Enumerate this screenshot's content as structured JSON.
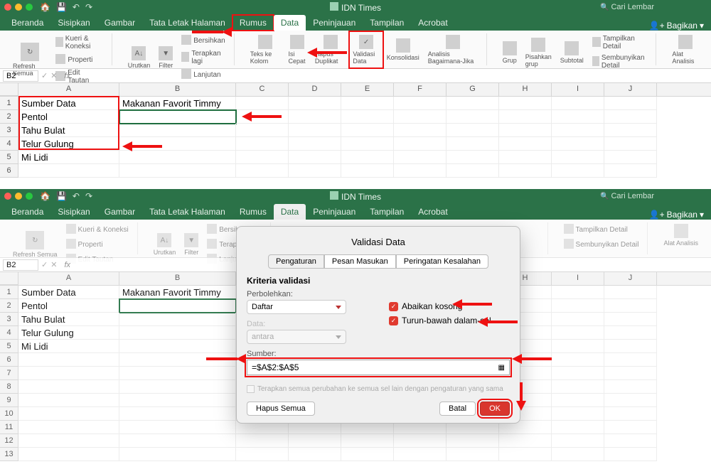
{
  "doc_title": "IDN Times",
  "search_placeholder": "Cari Lembar",
  "share_label": "Bagikan",
  "tabs": [
    "Beranda",
    "Sisipkan",
    "Gambar",
    "Tata Letak Halaman",
    "Rumus",
    "Data",
    "Peninjauan",
    "Tampilan",
    "Acrobat"
  ],
  "active_tab": "Data",
  "ribbon": {
    "refresh": "Refresh Semua",
    "kueri": "Kueri & Koneksi",
    "properti": "Properti",
    "edit_tautan": "Edit Tautan",
    "urutkan": "Urutkan",
    "filter": "Filter",
    "bersihkan": "Bersihkan",
    "terapkan": "Terapkan lagi",
    "lanjutan": "Lanjutan",
    "teks_kolom": "Teks ke Kolom",
    "isi_cepat": "Isi Cepat",
    "hapus_dup": "Hapus Duplikat",
    "validasi": "Validasi Data",
    "konsolidasi": "Konsolidasi",
    "analisis": "Analisis Bagaimana-Jika",
    "grup": "Grup",
    "pisahkan": "Pisahkan grup",
    "subtotal": "Subtotal",
    "tampilkan": "Tampilkan Detail",
    "sembunyikan": "Sembunyikan Detail",
    "alat": "Alat Analisis"
  },
  "namebox": "B2",
  "cols": [
    "A",
    "B",
    "C",
    "D",
    "E",
    "F",
    "G",
    "H",
    "I",
    "J"
  ],
  "data": {
    "A1": "Sumber Data",
    "B1": "Makanan Favorit Timmy",
    "A2": "Pentol",
    "A3": "Tahu Bulat",
    "A4": "Telur Gulung",
    "A5": "Mi Lidi"
  },
  "dialog": {
    "title": "Validasi Data",
    "tabs": [
      "Pengaturan",
      "Pesan Masukan",
      "Peringatan Kesalahan"
    ],
    "kriteria": "Kriteria validasi",
    "perbolehkan": "Perbolehkan:",
    "perbolehkan_val": "Daftar",
    "data_lbl": "Data:",
    "data_val": "antara",
    "abaikan": "Abaikan kosong",
    "turun": "Turun-bawah dalam-sel",
    "sumber": "Sumber:",
    "sumber_val": "=$A$2:$A$5",
    "note": "Terapkan semua perubahan ke semua sel lain dengan pengaturan yang sama",
    "hapus": "Hapus Semua",
    "batal": "Batal",
    "ok": "OK"
  }
}
